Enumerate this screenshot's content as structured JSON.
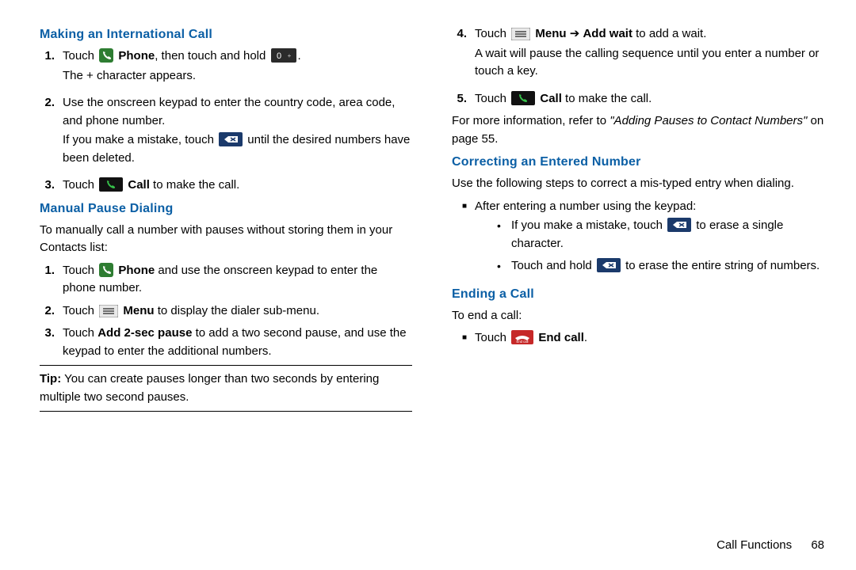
{
  "left": {
    "headings": {
      "intl": "Making an International Call",
      "manual": "Manual Pause Dialing"
    },
    "intl_steps": [
      {
        "num": "1.",
        "pre": "Touch ",
        "bold1": "Phone",
        "mid": ", then touch and hold ",
        "tail": ".",
        "line2": "The + character appears."
      },
      {
        "num": "2.",
        "body1": "Use the onscreen keypad to enter the country code, area code, and phone number.",
        "body2a": "If you make a mistake, touch ",
        "body2b": " until the desired numbers have been deleted."
      },
      {
        "num": "3.",
        "pre": "Touch ",
        "bold1": "Call",
        "tail": " to make the call."
      }
    ],
    "manual_intro": "To manually call a number with pauses without storing them in your Contacts list:",
    "manual_steps": [
      {
        "num": "1.",
        "pre": "Touch ",
        "bold1": "Phone",
        "tail": " and use the onscreen keypad to enter the phone number."
      },
      {
        "num": "2.",
        "pre": "Touch ",
        "bold1": "Menu",
        "tail": " to display the dialer sub-menu."
      },
      {
        "num": "3.",
        "pre": "Touch ",
        "bold1": "Add 2-sec pause",
        "tail": " to add a two second pause, and use the keypad to enter the additional numbers."
      }
    ],
    "tip_label": "Tip:",
    "tip_body": " You can create pauses longer than two seconds by entering multiple two second pauses."
  },
  "right": {
    "steps_cont": [
      {
        "num": "4.",
        "pre": "Touch ",
        "bold1": "Menu ",
        "arrow": "➔ ",
        "bold2": "Add wait",
        "tail": " to add a wait.",
        "line2": "A wait will pause the calling sequence until you enter a number or touch a key."
      },
      {
        "num": "5.",
        "pre": "Touch ",
        "bold1": "Call",
        "tail": " to make the call."
      }
    ],
    "more_info_a": "For more information, refer to ",
    "more_info_i": "\"Adding Pauses to Contact Numbers\"",
    "more_info_b": " on page 55.",
    "headings": {
      "correct": "Correcting an Entered Number",
      "ending": "Ending a Call"
    },
    "correct_intro": "Use the following steps to correct a mis-typed entry when dialing.",
    "correct_square": "After entering a number using the keypad:",
    "correct_b1a": "If you make a mistake, touch ",
    "correct_b1b": " to erase a single character.",
    "correct_b2a": "Touch and hold ",
    "correct_b2b": " to erase the entire string of numbers.",
    "ending_intro": "To end a call:",
    "ending_item_pre": "Touch ",
    "ending_item_bold": "End call",
    "ending_item_tail": "."
  },
  "footer": {
    "section": "Call Functions",
    "page": "68"
  }
}
